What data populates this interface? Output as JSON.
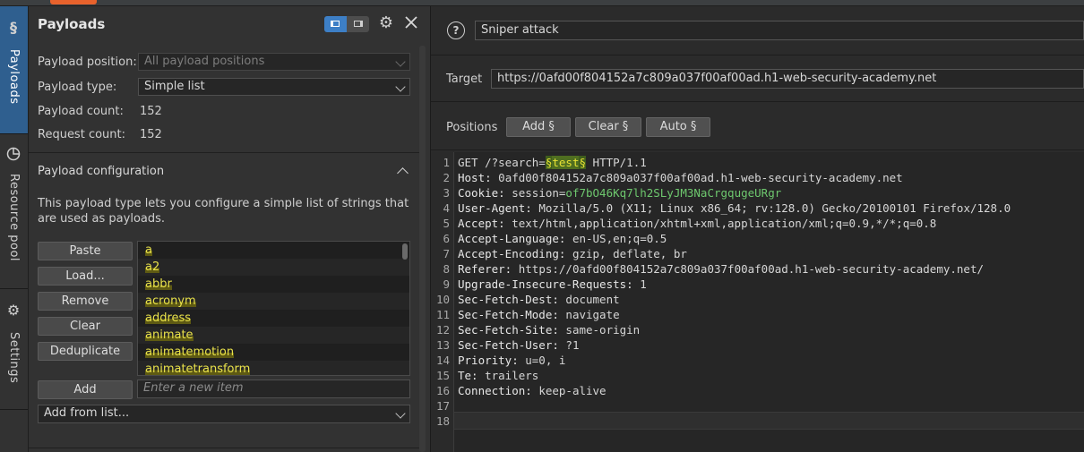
{
  "tabs": [
    {
      "label": "Payloads",
      "icon": "dollar-icon",
      "active": true
    },
    {
      "label": "Resource pool",
      "icon": "pie-chart-icon",
      "active": false
    },
    {
      "label": "Settings",
      "icon": "gear-icon",
      "active": false
    }
  ],
  "panel": {
    "title": "Payloads",
    "position_label": "Payload position:",
    "position_value": "All payload positions",
    "type_label": "Payload type:",
    "type_value": "Simple list",
    "count_label": "Payload count:",
    "count_value": "152",
    "request_label": "Request count:",
    "request_value": "152",
    "config_title": "Payload configuration",
    "config_desc": "This payload type lets you configure a simple list of strings that are used as payloads.",
    "buttons": {
      "paste": "Paste",
      "load": "Load...",
      "remove": "Remove",
      "clear": "Clear",
      "dedup": "Deduplicate",
      "add": "Add"
    },
    "items": [
      "a",
      "a2",
      "abbr",
      "acronym",
      "address",
      "animate",
      "animatemotion",
      "animatetransform"
    ],
    "new_item_placeholder": "Enter a new item",
    "add_from_list": "Add from list..."
  },
  "attack": {
    "help": "?",
    "type": "Sniper attack"
  },
  "target": {
    "label": "Target",
    "url": "https://0afd00f804152a7c809a037f00af00ad.h1-web-security-academy.net"
  },
  "positions": {
    "label": "Positions",
    "add": "Add §",
    "clear": "Clear §",
    "auto": "Auto §"
  },
  "request": {
    "line1": {
      "pre": "GET /?search=",
      "mark_open": "§",
      "var": "test",
      "mark_close": "§",
      "post": " HTTP/1.1"
    },
    "headers": [
      {
        "name": "Host:",
        "value": " 0afd00f804152a7c809a037f00af00ad.h1-web-security-academy.net"
      },
      {
        "name": "Cookie:",
        "value": " session=",
        "cookie": "of7bO46Kq7lh2SLyJM3NaCrgqugeURgr"
      },
      {
        "name": "User-Agent:",
        "value": " Mozilla/5.0 (X11; Linux x86_64; rv:128.0) Gecko/20100101 Firefox/128.0"
      },
      {
        "name": "Accept:",
        "value": " text/html,application/xhtml+xml,application/xml;q=0.9,*/*;q=0.8"
      },
      {
        "name": "Accept-Language:",
        "value": " en-US,en;q=0.5"
      },
      {
        "name": "Accept-Encoding:",
        "value": " gzip, deflate, br"
      },
      {
        "name": "Referer:",
        "value": " https://0afd00f804152a7c809a037f00af00ad.h1-web-security-academy.net/"
      },
      {
        "name": "Upgrade-Insecure-Requests:",
        "value": " 1"
      },
      {
        "name": "Sec-Fetch-Dest:",
        "value": " document"
      },
      {
        "name": "Sec-Fetch-Mode:",
        "value": " navigate"
      },
      {
        "name": "Sec-Fetch-Site:",
        "value": " same-origin"
      },
      {
        "name": "Sec-Fetch-User:",
        "value": " ?1"
      },
      {
        "name": "Priority:",
        "value": " u=0, i"
      },
      {
        "name": "Te:",
        "value": " trailers"
      },
      {
        "name": "Connection:",
        "value": " keep-alive"
      }
    ],
    "line_numbers": [
      "1",
      "2",
      "3",
      "4",
      "5",
      "6",
      "7",
      "8",
      "9",
      "10",
      "11",
      "12",
      "13",
      "14",
      "15",
      "16",
      "17",
      "18"
    ]
  }
}
